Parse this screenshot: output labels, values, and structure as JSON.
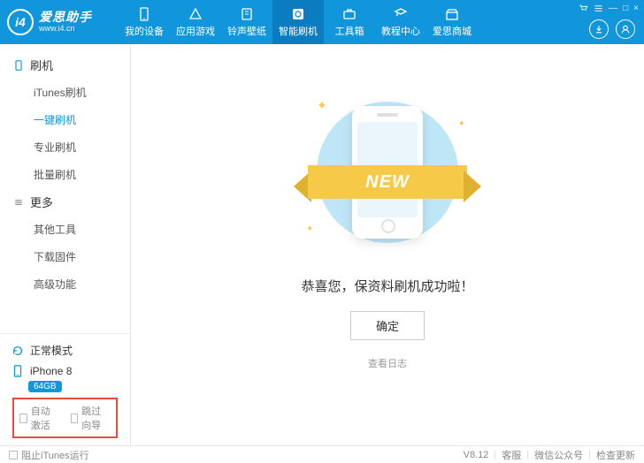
{
  "app": {
    "title": "爱思助手",
    "url": "www.i4.cn",
    "logo_text": "i4"
  },
  "nav": {
    "items": [
      {
        "label": "我的设备"
      },
      {
        "label": "应用游戏"
      },
      {
        "label": "铃声壁纸"
      },
      {
        "label": "智能刷机"
      },
      {
        "label": "工具箱"
      },
      {
        "label": "教程中心"
      },
      {
        "label": "爱思商城"
      }
    ]
  },
  "window_controls": {
    "cart": "",
    "settings": "",
    "min": "—",
    "max": "□",
    "close": "×"
  },
  "sidebar": {
    "section1": {
      "title": "刷机",
      "items": [
        "iTunes刷机",
        "一键刷机",
        "专业刷机",
        "批量刷机"
      ]
    },
    "section2": {
      "title": "更多",
      "items": [
        "其他工具",
        "下载固件",
        "高级功能"
      ]
    },
    "mode": "正常模式",
    "device": "iPhone 8",
    "storage": "64GB",
    "check1": "自动激活",
    "check2": "跳过向导"
  },
  "main": {
    "ribbon": "NEW",
    "message": "恭喜您，保资料刷机成功啦！",
    "ok": "确定",
    "log": "查看日志"
  },
  "footer": {
    "block_itunes": "阻止iTunes运行",
    "version": "V8.12",
    "support": "客服",
    "wechat": "微信公众号",
    "update": "检查更新"
  }
}
